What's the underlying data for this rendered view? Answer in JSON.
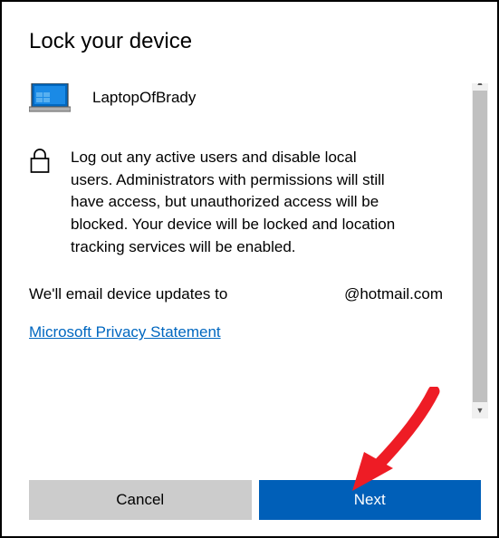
{
  "title": "Lock your device",
  "device": {
    "name": "LaptopOfBrady"
  },
  "description": "Log out any active users and disable local users. Administrators with permissions will still have access, but unauthorized access will be blocked. Your device will be locked and location tracking services will be enabled.",
  "email_notice_prefix": "We'll email device updates to",
  "email_domain": "@hotmail.com",
  "privacy_link": "Microsoft Privacy Statement",
  "buttons": {
    "cancel": "Cancel",
    "next": "Next"
  }
}
